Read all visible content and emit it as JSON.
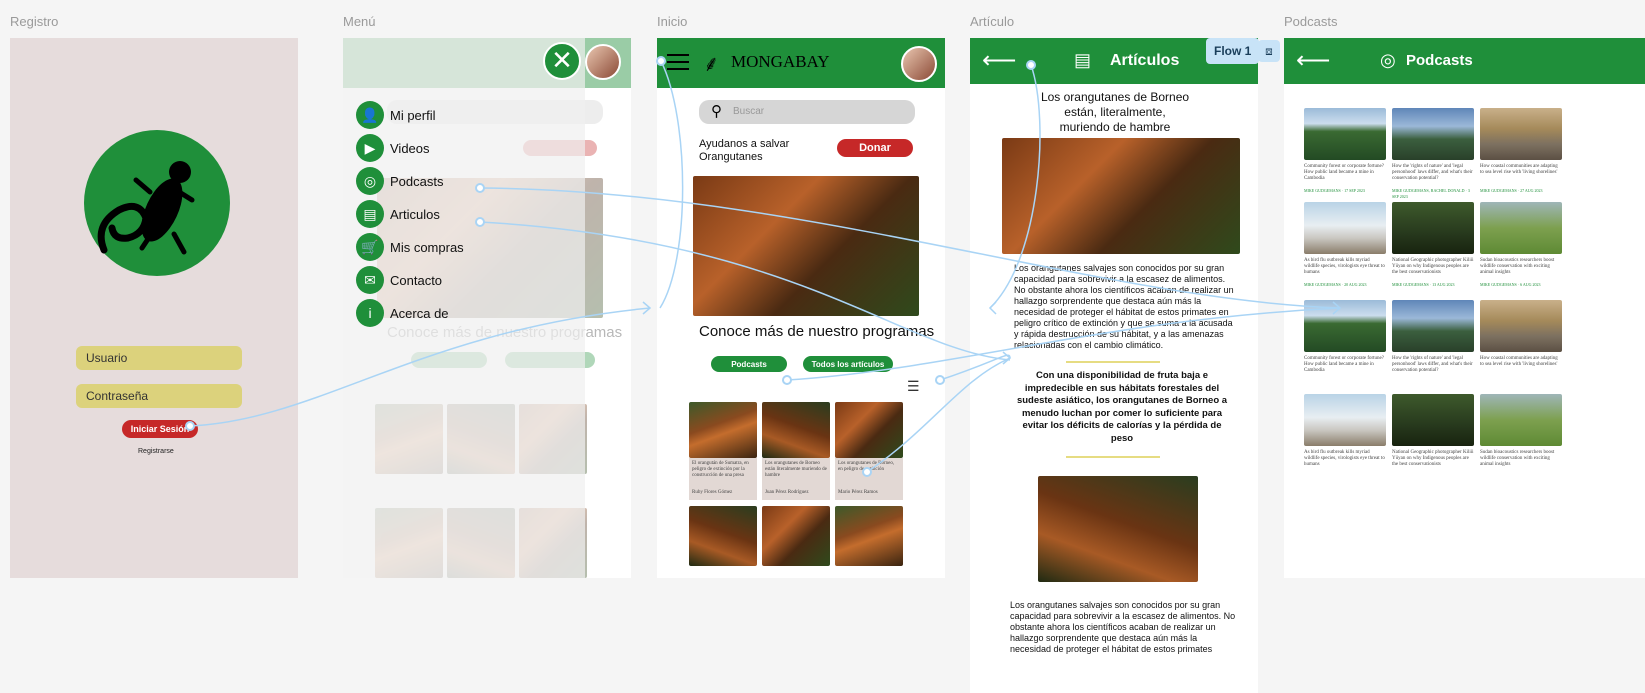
{
  "frames": {
    "registro": {
      "label": "Registro",
      "username_placeholder": "Usuario",
      "password_placeholder": "Contraseña",
      "login_button": "Iniciar Sesión",
      "register_link": "Registrarse"
    },
    "menu": {
      "label": "Menú",
      "items": [
        "Mi perfil",
        "Videos",
        "Podcasts",
        "Articulos",
        "Mis compras",
        "Contacto",
        "Acerca de"
      ],
      "close_icon": "close-icon"
    },
    "inicio": {
      "label": "Inicio",
      "brand": "MONGABAY",
      "search_placeholder": "Buscar",
      "donate_text": "Ayudanos a salvar Orangutanes",
      "donate_button": "Donar",
      "programs_heading": "Conoce más de nuestro programas",
      "tab_podcasts": "Podcasts",
      "tab_articles": "Todos los artículos",
      "cards": [
        {
          "text": "El orangután de Sumatra, en peligro de extinción por la construcción de una presa",
          "author": "Ruby Flores Gómez"
        },
        {
          "text": "Los orangutanes de Borneo están literalmente muriendo de hambre",
          "author": "Juan Pérez Rodríguez"
        },
        {
          "text": "Los orangutanes de Borneo, en peligro de extinción",
          "author": "Mario Pérez Ramos"
        }
      ]
    },
    "articulo": {
      "label": "Artículo",
      "header": "Artículos",
      "title": "Los orangutanes de Borneo están, literalmente, muriendo de hambre",
      "paragraph1": "Los orangutanes salvajes son conocidos por su gran capacidad para sobrevivir a la escasez de alimentos. No obstante ahora los científicos acaban de realizar un hallazgo sorprendente que destaca aún más la necesidad de proteger el hábitat de estos primates en peligro crítico de extinción y que se suma a la acusada y rápida destrucción de su hábitat, y a las amenazas relacionadas con el cambio climático.",
      "quote": "Con una disponibilidad de fruta baja e impredecible en sus hábitats forestales del sudeste asiático, los orangutanes de Borneo a menudo luchan por comer lo suficiente para evitar los déficits de calorías y la pérdida de peso",
      "paragraph2": "Los orangutanes salvajes son conocidos por su gran capacidad para sobrevivir a la escasez de alimentos. No obstante ahora los científicos acaban de realizar un hallazgo sorprendente que destaca aún más la necesidad de proteger el hábitat de estos primates"
    },
    "podcasts": {
      "label": "Podcasts",
      "header": "Podcasts",
      "flow_label": "Flow 1",
      "cards": [
        {
          "text": "Community forest or corporate fortune? How public land became a mine in Cambodia",
          "meta": "MIKE GUDGEMANS · 17 SEP 2023"
        },
        {
          "text": "How the 'rights of nature' and 'legal personhood' laws differ, and what's their conservation potential?",
          "meta": "MIKE GUDGEMANS, RACHEL DONALD · 3 SEP 2023"
        },
        {
          "text": "How coastal communities are adapting to sea level rise with 'living shorelines'",
          "meta": "MIKE GUDGEMANS · 27 AUG 2023"
        },
        {
          "text": "As bird flu outbreak kills myriad wildlife species, virologists eye threat to humans",
          "meta": "MIKE GUDGEMANS · 20 AUG 2023"
        },
        {
          "text": "National Geographic photographer Kiliii Yüyan on why Indigenous peoples are the best conservationists",
          "meta": "MIKE GUDGEMANS · 13 AUG 2023"
        },
        {
          "text": "Sudan bioacoustics researchers boost wildlife conservation with exciting animal insights",
          "meta": "MIKE GUDGEMANS · 6 AUG 2023"
        }
      ]
    }
  }
}
